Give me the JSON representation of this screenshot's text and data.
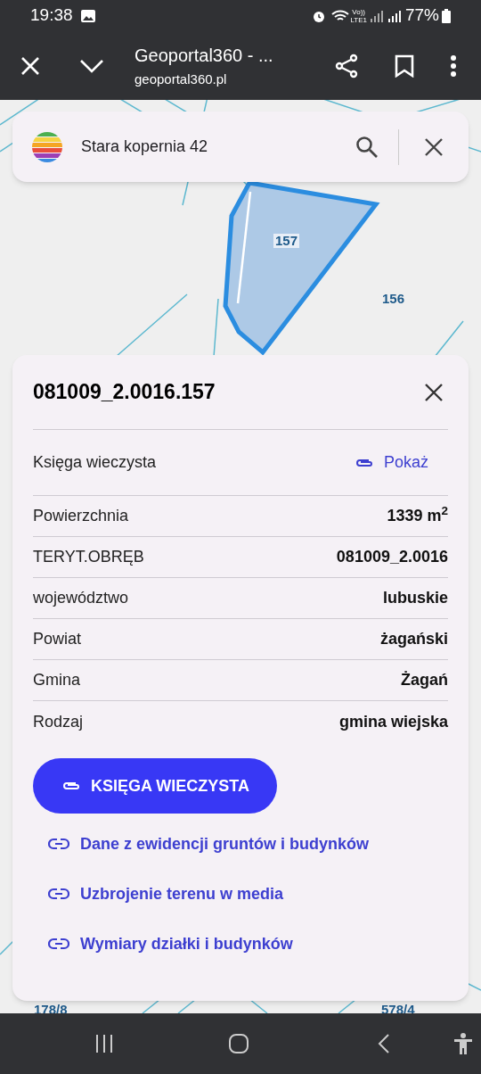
{
  "status_bar": {
    "time": "19:38",
    "battery": "77%",
    "network": "Vo))\nLTE1"
  },
  "browser_bar": {
    "title": "Geoportal360 - ...",
    "url": "geoportal360.pl"
  },
  "search": {
    "value": "Stara kopernia 42"
  },
  "map_labels": [
    {
      "text": "157",
      "kind": "selected"
    },
    {
      "text": "156",
      "kind": "plain"
    },
    {
      "text": "178/8",
      "kind": "plain"
    },
    {
      "text": "578/4",
      "kind": "plain"
    }
  ],
  "parcel": {
    "title": "081009_2.0016.157",
    "land_register": {
      "label": "Księga wieczysta",
      "link": "Pokaż"
    },
    "rows": [
      {
        "label": "Powierzchnia",
        "value": "1339 m$^{2}$"
      },
      {
        "label": "TERYT.OBRĘB",
        "value": "081009_2.0016"
      },
      {
        "label": "województwo",
        "value": "lubuskie"
      },
      {
        "label": "Powiat",
        "value": "żagański"
      },
      {
        "label": "Gmina",
        "value": "Żagań"
      },
      {
        "label": "Rodzaj",
        "value": "gmina wiejska"
      }
    ],
    "button": "KSIĘGA WIECZYSTA",
    "links": [
      "Dane z ewidencji gruntów i budynków",
      "Uzbrojenie terenu w media",
      "Wymiary działki i budynków"
    ]
  }
}
